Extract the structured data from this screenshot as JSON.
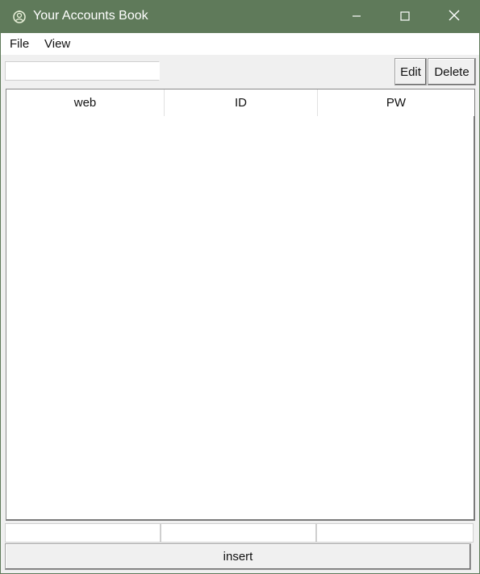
{
  "window": {
    "title": "Your Accounts Book",
    "icons": {
      "app": "app-icon",
      "minimize": "minimize-icon",
      "maximize": "maximize-icon",
      "close": "close-icon"
    },
    "colors": {
      "titlebar": "#5f7a5a",
      "background": "#f0f0f0"
    }
  },
  "menu": {
    "items": [
      {
        "label": "File"
      },
      {
        "label": "View"
      }
    ]
  },
  "toolbar": {
    "search_value": "",
    "edit_label": "Edit",
    "delete_label": "Delete"
  },
  "table": {
    "columns": [
      {
        "label": "web"
      },
      {
        "label": "ID"
      },
      {
        "label": "PW"
      }
    ],
    "rows": []
  },
  "form": {
    "web_value": "",
    "id_value": "",
    "pw_value": "",
    "insert_label": "insert"
  }
}
